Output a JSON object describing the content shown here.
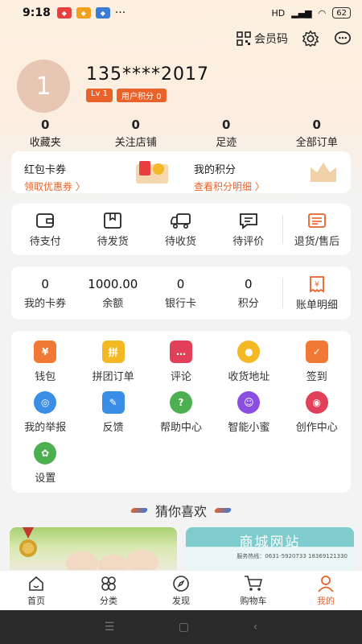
{
  "status": {
    "time": "9:18",
    "battery": "62",
    "net": "HD"
  },
  "header": {
    "member_code": "会员码"
  },
  "profile": {
    "avatar_text": "1",
    "phone": "135****2017",
    "level": "Lv 1",
    "points_badge": "用户积分 0"
  },
  "stats": [
    {
      "num": "0",
      "label": "收藏夹"
    },
    {
      "num": "0",
      "label": "关注店铺"
    },
    {
      "num": "0",
      "label": "足迹"
    },
    {
      "num": "0",
      "label": "全部订单"
    }
  ],
  "promo": {
    "coupon_title": "红包卡券",
    "coupon_sub": "领取优惠券 〉",
    "points_title": "我的积分",
    "points_sub": "查看积分明细 〉"
  },
  "orders": [
    {
      "label": "待支付",
      "icon": "wallet-icon"
    },
    {
      "label": "待发货",
      "icon": "box-icon"
    },
    {
      "label": "待收货",
      "icon": "truck-icon"
    },
    {
      "label": "待评价",
      "icon": "comment-icon"
    },
    {
      "label": "退货/售后",
      "icon": "return-icon"
    }
  ],
  "wallet": [
    {
      "num": "0",
      "label": "我的卡券"
    },
    {
      "num": "1000.00",
      "label": "余额"
    },
    {
      "num": "0",
      "label": "银行卡"
    },
    {
      "num": "0",
      "label": "积分"
    },
    {
      "label": "账单明细"
    }
  ],
  "services": [
    {
      "label": "钱包",
      "color": "#f07a35",
      "glyph": "¥"
    },
    {
      "label": "拼团订单",
      "color": "#f3b824",
      "glyph": "拼"
    },
    {
      "label": "评论",
      "color": "#e0405a",
      "glyph": "…"
    },
    {
      "label": "收货地址",
      "color": "#f3b824",
      "glyph": "●"
    },
    {
      "label": "签到",
      "color": "#f07a35",
      "glyph": "✓"
    },
    {
      "label": "我的举报",
      "color": "#3a8ee6",
      "glyph": "◎"
    },
    {
      "label": "反馈",
      "color": "#3a8ee6",
      "glyph": "✎"
    },
    {
      "label": "帮助中心",
      "color": "#4cb050",
      "glyph": "?"
    },
    {
      "label": "智能小蜜",
      "color": "#8a4fe0",
      "glyph": "☺"
    },
    {
      "label": "创作中心",
      "color": "#e0405a",
      "glyph": "◉"
    },
    {
      "label": "设置",
      "color": "#4cb050",
      "glyph": "✿"
    }
  ],
  "guess_title": "猜你喜欢",
  "product2": {
    "title": "商城网站",
    "hotline": "服务热线：0631-5920733  18369121330"
  },
  "tabs": [
    {
      "label": "首页"
    },
    {
      "label": "分类"
    },
    {
      "label": "发现"
    },
    {
      "label": "购物车"
    },
    {
      "label": "我的"
    }
  ],
  "colors": {
    "accent": "#e8622a"
  }
}
